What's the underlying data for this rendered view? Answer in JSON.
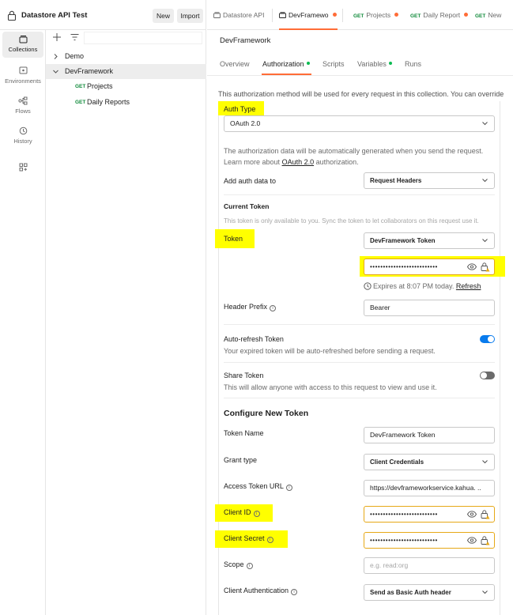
{
  "workspace": {
    "title": "Datastore API Test",
    "new_label": "New",
    "import_label": "Import"
  },
  "rail": [
    {
      "label": "Collections",
      "icon": "collections-icon"
    },
    {
      "label": "Environments",
      "icon": "environments-icon"
    },
    {
      "label": "Flows",
      "icon": "flows-icon"
    },
    {
      "label": "History",
      "icon": "history-icon"
    }
  ],
  "tree": {
    "demo": "Demo",
    "devframework": "DevFramework",
    "requests": [
      {
        "method": "GET",
        "name": "Projects"
      },
      {
        "method": "GET",
        "name": "Daily Reports"
      }
    ]
  },
  "tabs": [
    {
      "label": "Datastore API"
    },
    {
      "label": "DevFramewo"
    },
    {
      "method": "GET",
      "label": "Projects"
    },
    {
      "method": "GET",
      "label": "Daily Report"
    },
    {
      "method": "GET",
      "label": "New"
    }
  ],
  "collection_name": "DevFramework",
  "subtabs": [
    "Overview",
    "Authorization",
    "Scripts",
    "Variables",
    "Runs"
  ],
  "auth": {
    "description": "This authorization method will be used for every request in this collection. You can override",
    "auth_type_label": "Auth Type",
    "auth_type_value": "OAuth 2.0",
    "info_line1": "The authorization data will be automatically generated when you send the request.",
    "info_line2_prefix": "Learn more about",
    "info_link": "OAuth 2.0",
    "info_line2_suffix": "authorization.",
    "add_auth_label": "Add auth data to",
    "add_auth_value": "Request Headers",
    "current_token_heading": "Current Token",
    "current_token_note": "This token is only available to you. Sync the token to let collaborators on this request use it.",
    "token_label": "Token",
    "token_value": "DevFramework Token",
    "token_masked": "••••••••••••••••••••••••••",
    "expires_text": "Expires at 8:07 PM today.",
    "refresh_label": "Refresh",
    "header_prefix_label": "Header Prefix",
    "header_prefix_value": "Bearer",
    "auto_refresh_label": "Auto-refresh Token",
    "auto_refresh_desc": "Your expired token will be auto-refreshed before sending a request.",
    "share_label": "Share Token",
    "share_desc": "This will allow anyone with access to this request to view and use it.",
    "configure_heading": "Configure New Token",
    "token_name_label": "Token Name",
    "token_name_value": "DevFramework Token",
    "grant_type_label": "Grant type",
    "grant_type_value": "Client Credentials",
    "access_url_label": "Access Token URL",
    "access_url_value": "https://devframeworkservice.kahua. ..",
    "client_id_label": "Client ID",
    "client_id_masked": "••••••••••••••••••••••••••",
    "client_secret_label": "Client Secret",
    "client_secret_masked": "••••••••••••••••••••••••••",
    "scope_label": "Scope",
    "scope_placeholder": "e.g. read:org",
    "client_auth_label": "Client Authentication",
    "client_auth_value": "Send as Basic Auth header"
  },
  "colors": {
    "accent": "#ff6c37",
    "highlight": "#ffff00",
    "get": "#0f8a3a",
    "toggle_on": "#097bed",
    "status_dot": "#0cbb52"
  }
}
